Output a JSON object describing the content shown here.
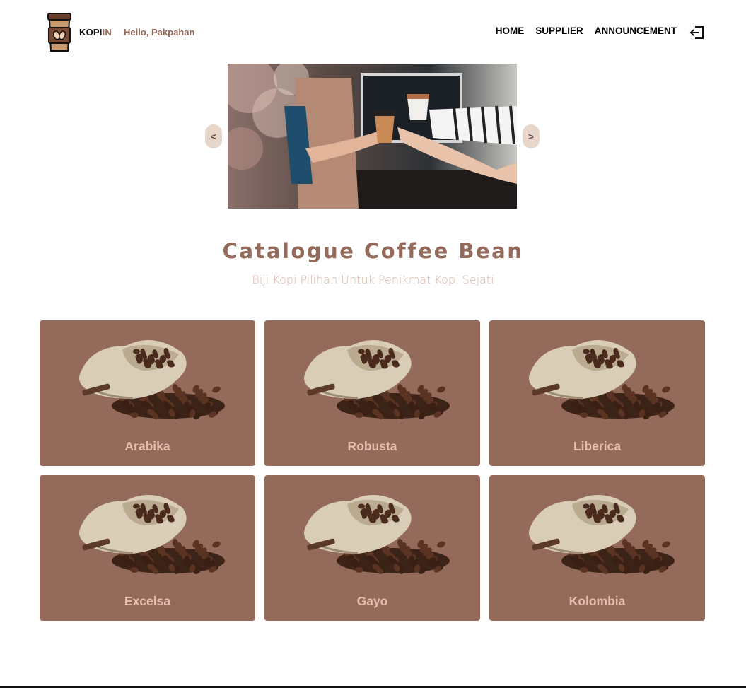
{
  "header": {
    "brand_part1": "KOPI",
    "brand_part2": "IN",
    "greeting": "Hello, Pakpahan",
    "nav": [
      "HOME",
      "SUPPLIER",
      "ANNOUNCEMENT"
    ],
    "logout_icon": "logout-icon"
  },
  "carousel": {
    "prev_label": "<",
    "next_label": ">",
    "image": "barista handing coffee cup photo"
  },
  "catalogue": {
    "title": "Catalogue Coffee Bean",
    "subtitle": "Biji Kopi Pilihan Untuk Penikmat Kopi Sejati",
    "items": [
      {
        "name": "Arabika"
      },
      {
        "name": "Robusta"
      },
      {
        "name": "Liberica"
      },
      {
        "name": "Excelsa"
      },
      {
        "name": "Gayo"
      },
      {
        "name": "Kolombia"
      }
    ]
  },
  "colors": {
    "accent": "#946a5a",
    "card_label": "#e5bfae",
    "arrow_bg": "#e7d6ca",
    "subtitle": "#dbb5a6"
  }
}
